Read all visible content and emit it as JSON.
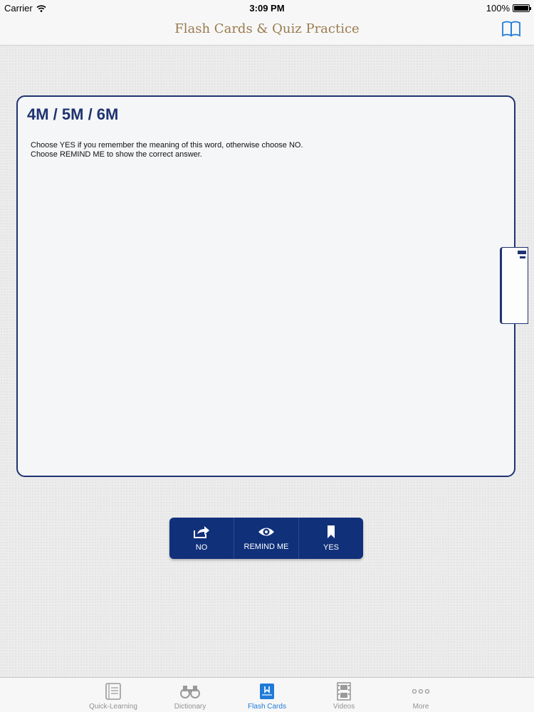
{
  "status_bar": {
    "carrier": "Carrier",
    "time": "3:09 PM",
    "battery": "100%"
  },
  "nav": {
    "title": "Flash Cards & Quiz Practice",
    "book_icon": "book-icon"
  },
  "card": {
    "title": "4M / 5M / 6M",
    "instruction_line1": "Choose YES if you remember the meaning of this word, otherwise choose NO.",
    "instruction_line2": "Choose REMIND ME to show the correct answer."
  },
  "actions": {
    "no": {
      "label": "NO",
      "icon": "share-arrow-icon"
    },
    "remind": {
      "label": "REMIND ME",
      "icon": "eye-icon"
    },
    "yes": {
      "label": "YES",
      "icon": "bookmark-icon"
    }
  },
  "tabs": [
    {
      "label": "Quick-Learning",
      "icon": "notebook-icon"
    },
    {
      "label": "Dictionary",
      "icon": "binoculars-icon"
    },
    {
      "label": "Flash Cards",
      "icon": "flashcards-icon"
    },
    {
      "label": "Videos",
      "icon": "filmstrip-icon"
    },
    {
      "label": "More",
      "icon": "more-dots-icon"
    }
  ],
  "colors": {
    "accent": "#1f3370",
    "button_bg": "#10307a",
    "tab_active": "#1f7bd8",
    "title": "#9a7a4e"
  }
}
